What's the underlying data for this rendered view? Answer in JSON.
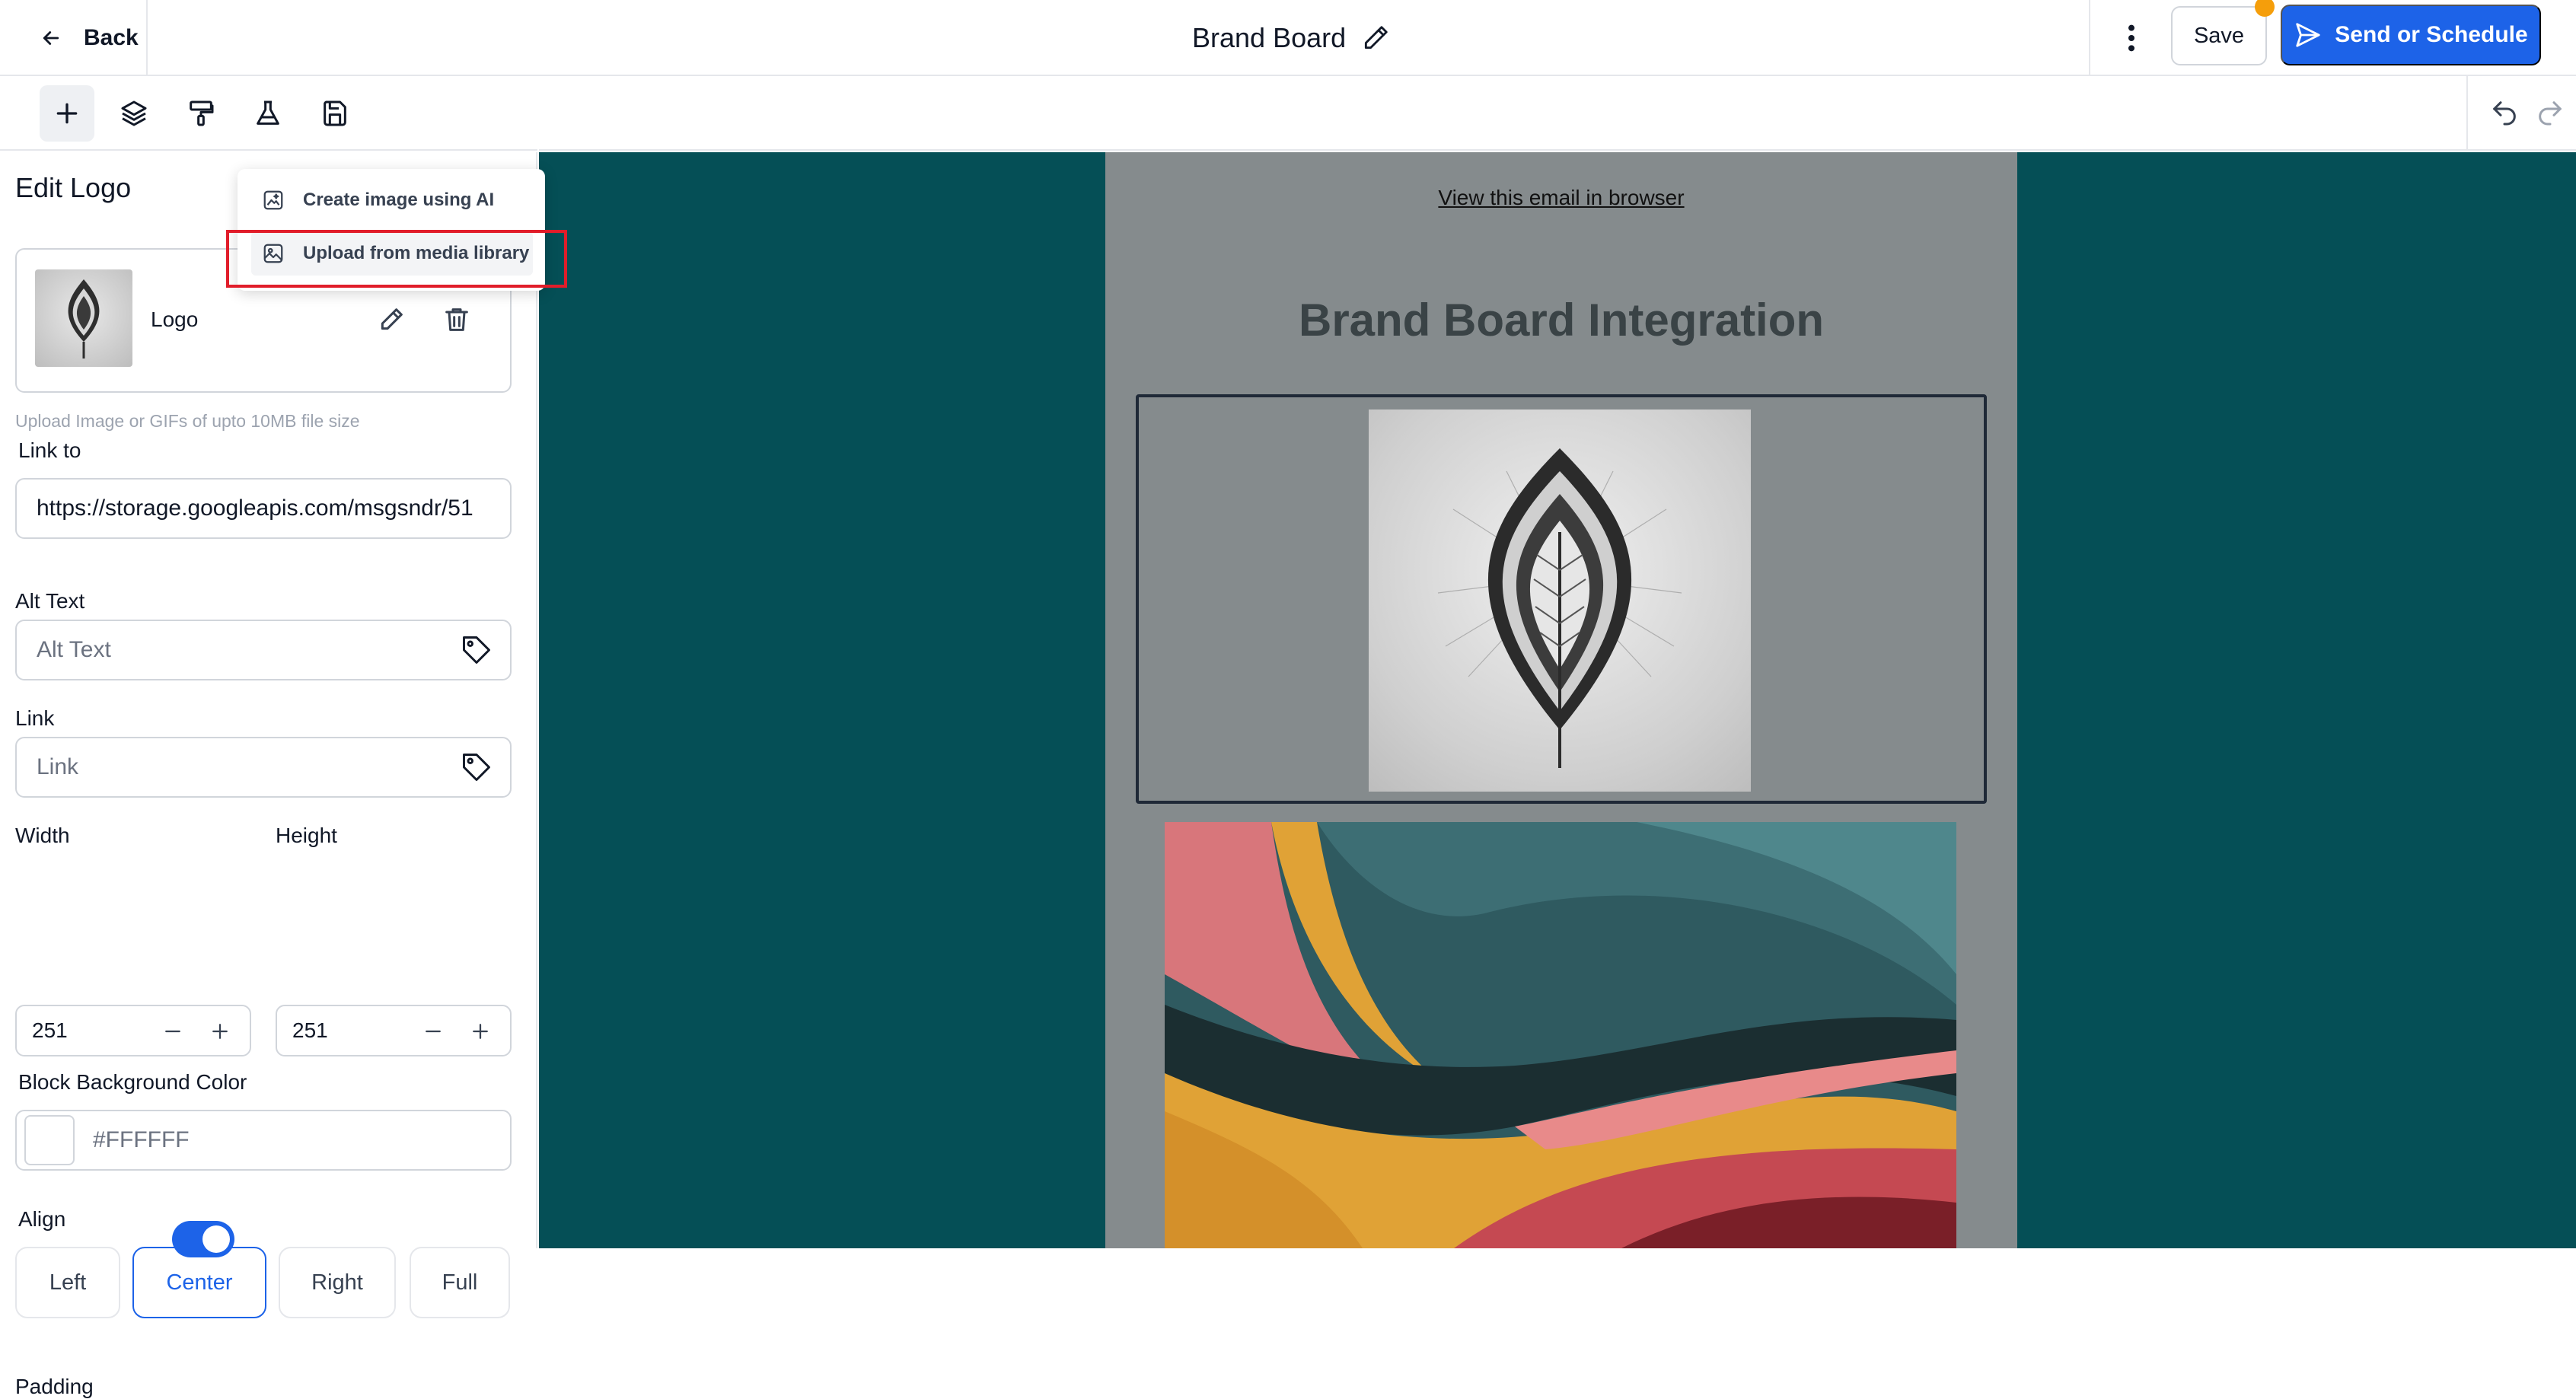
{
  "header": {
    "back_label": "Back",
    "title": "Brand Board",
    "save_label": "Save",
    "send_label": "Send or Schedule"
  },
  "toolbar": {
    "tools": [
      "plus-icon",
      "layers-icon",
      "paint-roller-icon",
      "flask-icon",
      "save-disk-icon"
    ],
    "active": "plus-icon"
  },
  "sidebar": {
    "title": "Edit Logo",
    "logo_name": "Logo",
    "helper": "Upload Image or GIFs of upto 10MB file size",
    "link_to_label": "Link to",
    "link_to_value": "https://storage.googleapis.com/msgsndr/51",
    "alt_text_label": "Alt Text",
    "alt_text_placeholder": "Alt Text",
    "link_label": "Link",
    "link_placeholder": "Link",
    "width_label": "Width",
    "width_value": "251",
    "height_label": "Height",
    "height_value": "251",
    "bg_color_label": "Block Background Color",
    "bg_color_value": "#FFFFFF",
    "align_label": "Align",
    "align_options": [
      "Left",
      "Center",
      "Right",
      "Full"
    ],
    "align_selected": "Center",
    "padding_label": "Padding",
    "padding_enabled": true
  },
  "dropdown": {
    "items": [
      "Create image using AI",
      "Upload from media library"
    ],
    "highlighted": "Upload from media library"
  },
  "email": {
    "view_link": "View this email in browser",
    "heading": "Brand Board Integration"
  },
  "colors": {
    "accent": "#1d63e8",
    "canvas_bg": "#054f56",
    "email_bg": "#858b8d",
    "highlight": "#e11d2a",
    "notification": "#f59e0b"
  }
}
